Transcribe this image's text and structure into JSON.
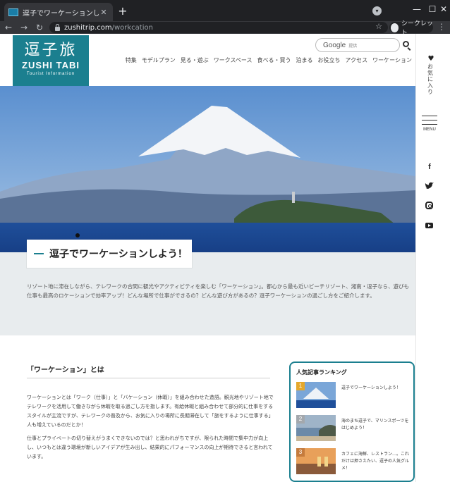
{
  "browser": {
    "tab_title": "逗子でワーケーションしよう！ | 特集",
    "url_host": "zushitrip.com",
    "url_path": "/workcation",
    "incognito_label": "シークレット"
  },
  "site": {
    "logo_kanji": "逗子旅",
    "logo_roman": "ZUSHI TABI",
    "logo_sub": "Tourist Information",
    "search_brand": "Google",
    "search_placeholder": "提供",
    "nav": [
      "特集",
      "モデルプラン",
      "見る・遊ぶ",
      "ワークスペース",
      "食べる・買う",
      "泊まる",
      "お役立ち",
      "アクセス",
      "ワーケーション"
    ],
    "favorites_label": "お気に入り",
    "menu_label": "MENU",
    "social": {
      "facebook": "f"
    },
    "accent_color": "#1b7f8f"
  },
  "hero": {
    "title": "逗子でワーケーションしよう！"
  },
  "intro": {
    "text": "リゾート地に滞在しながら、テレワークの合間に観光やアクティビティを楽しむ「ワーケーション」。都心から最も近いビーチリゾート、湘南・逗子なら、遊びも仕事も最高のロケーションで効率アップ！どんな場所で仕事ができるの？どんな遊び方があるの？逗子ワーケーションの過ごし方をご紹介します。"
  },
  "article": {
    "heading": "「ワーケーション」とは",
    "para1": "ワーケーションとは「ワーク（仕事）」と「バケーション（休暇）」を組み合わせた造語。観光地やリゾート地でテレワークを活用して働きながら休暇を取る過ごし方を指します。有給休暇と組み合わせて部分的に仕事をするスタイルが主流ですが、テレワークの普及から、お気に入りの場所に長期滞在して「旅をするように仕事する」人も増えているのだとか！",
    "para2": "仕事とプライベートの切り替えがうまくできないのでは？と思われがちですが、限られた時間で集中力が向上し、いつもとは違う環境が新しいアイデアが生み出し、結果的にパフォーマンスの向上が期待できると言われています。"
  },
  "ranking": {
    "title": "人気記事ランキング",
    "items": [
      {
        "rank": "1",
        "text": "逗子でワーケーションしよう！"
      },
      {
        "rank": "2",
        "text": "海のまち逗子で、マリンスポーツをはじめよう！"
      },
      {
        "rank": "3",
        "text": "カフェに海鮮、レストラン…。これだけは押さえたい、逗子の人気グルメ！"
      }
    ]
  }
}
